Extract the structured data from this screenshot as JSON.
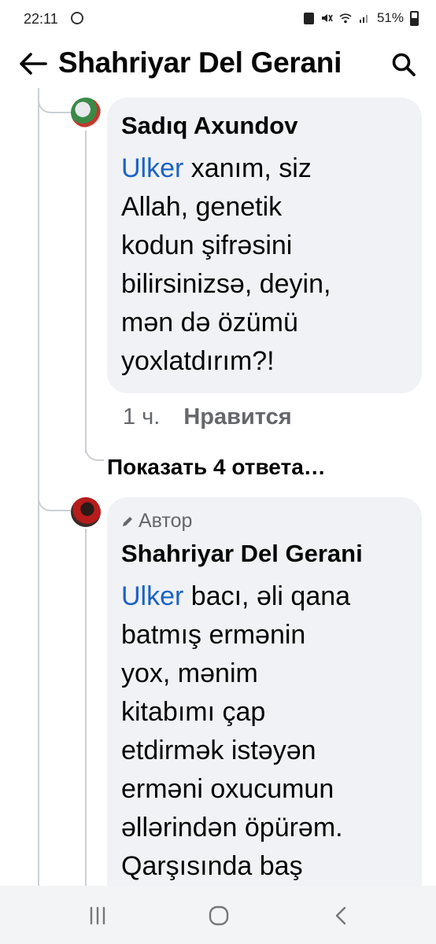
{
  "status_bar": {
    "time": "22:11",
    "battery": "51%"
  },
  "header": {
    "title": "Shahriyar Del Gerani"
  },
  "comments": [
    {
      "author": "Sadıq Axundov",
      "mention": "Ulker",
      "text_lines": [
        "xanım, siz",
        "Allah, genetik",
        "kodun şifrəsini",
        "bilirsinizsə, deyin,",
        "mən də özümü",
        "yoxlatdırım?!"
      ],
      "time": "1 ч.",
      "like_label": "Нравится",
      "show_replies": "Показать 4 ответа…"
    },
    {
      "badge": "Автор",
      "author": "Shahriyar Del Gerani",
      "mention": "Ulker",
      "text_lines": [
        "bacı, əli qana",
        "batmış ermənin",
        "yox, mənim",
        "kitabımı çap",
        "etdirmək istəyən",
        "erməni oxucumun",
        "əllərindən öpürəm.",
        "Qarşısında baş"
      ]
    }
  ],
  "colors": {
    "mention": "#1a63c5",
    "bubble": "#f0f2f5",
    "secondary_text": "#65676b"
  }
}
